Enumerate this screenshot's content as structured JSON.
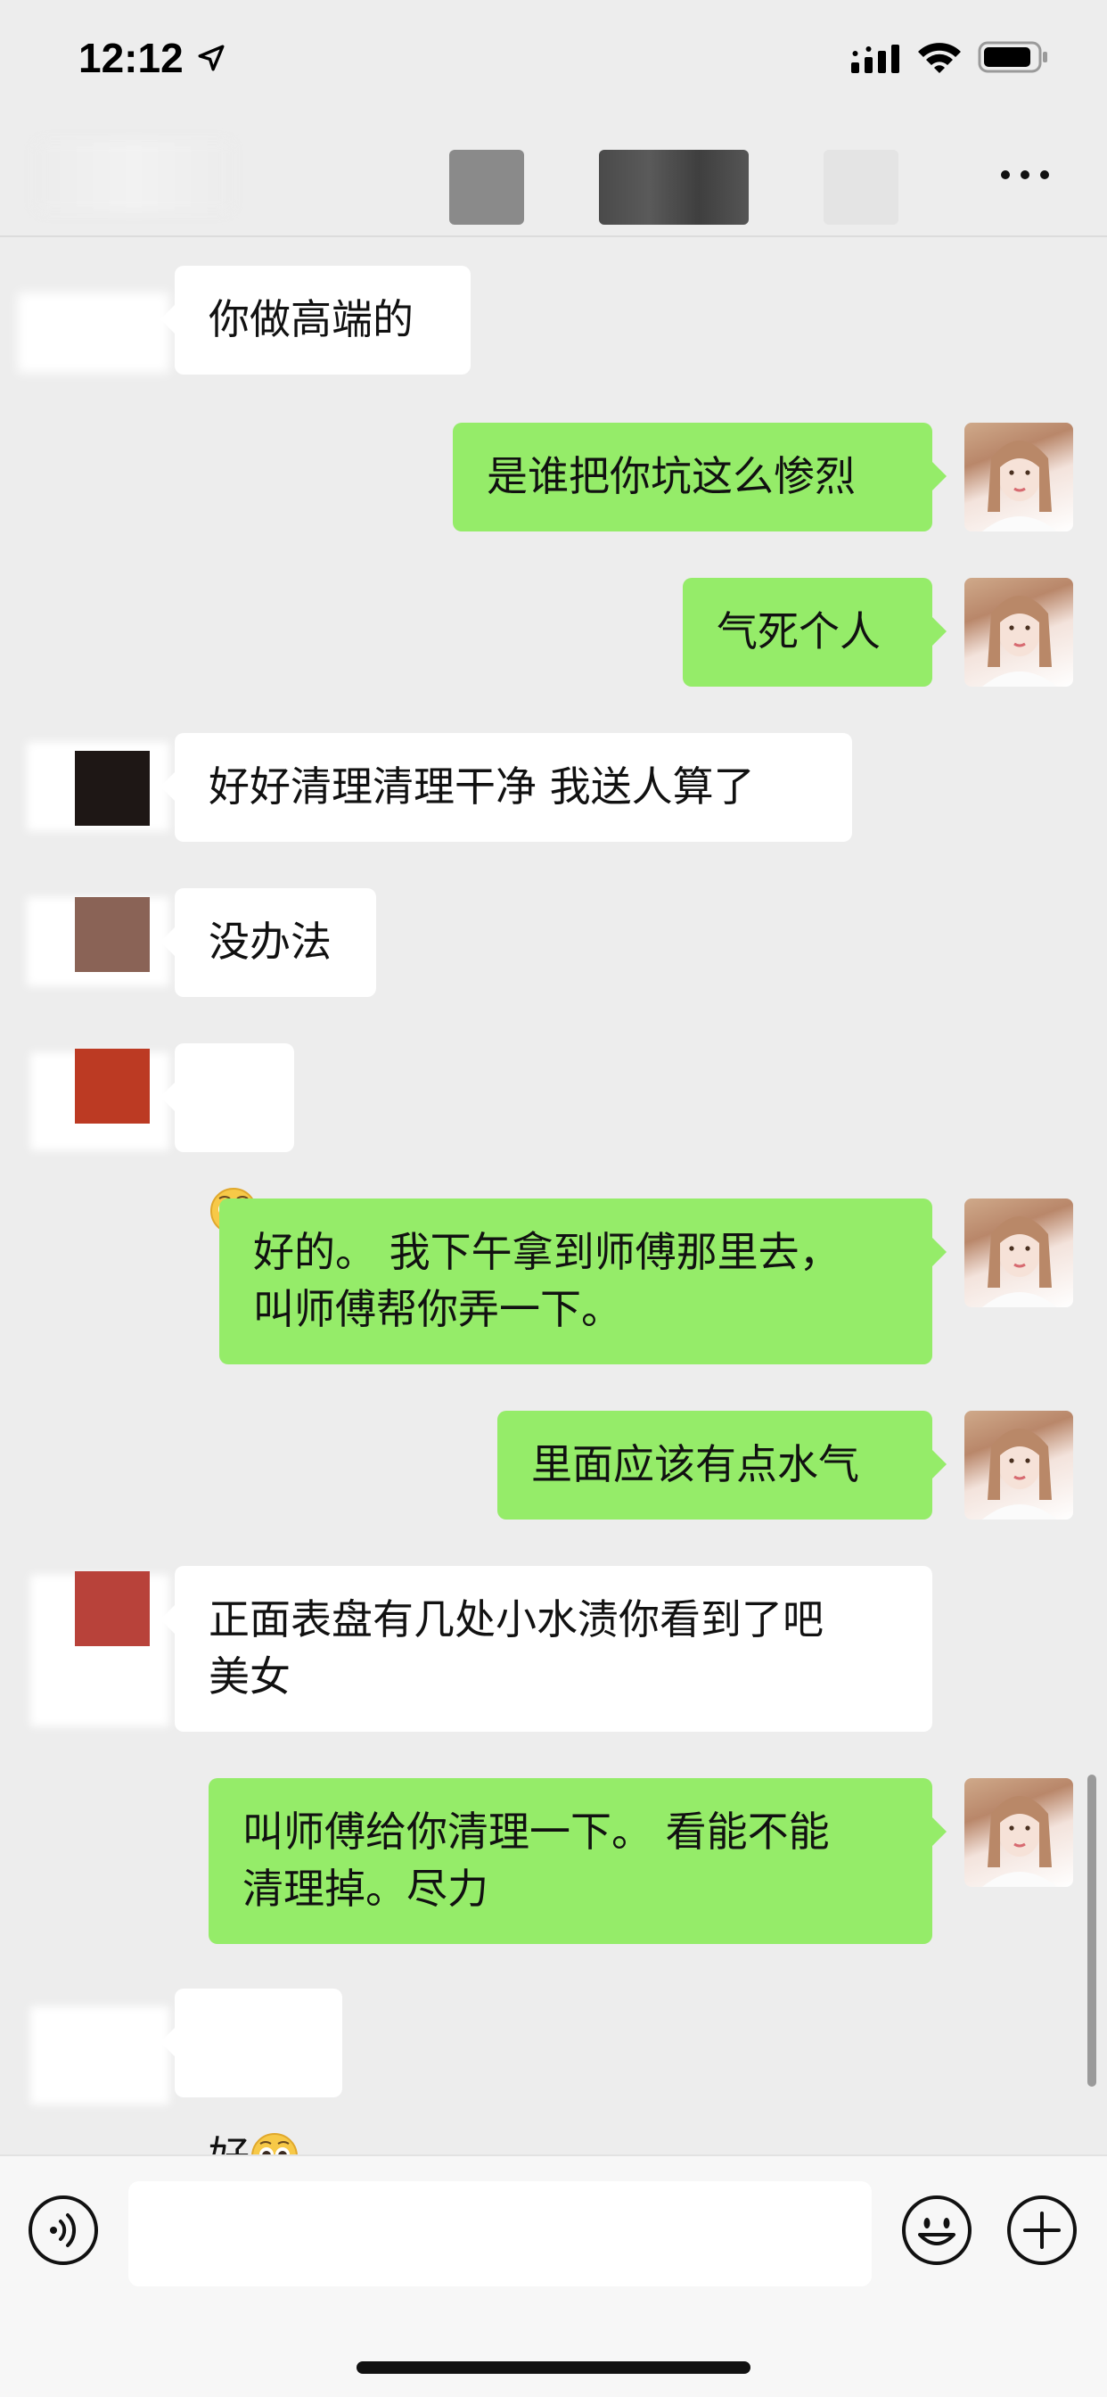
{
  "status_bar": {
    "time": "12:12",
    "icons": [
      "location-arrow-icon",
      "cellular-signal-icon",
      "wifi-icon",
      "battery-icon"
    ]
  },
  "nav": {
    "more_icon": "more-dots-icon"
  },
  "messages": [
    {
      "side": "in",
      "text": "你做高端的"
    },
    {
      "side": "out",
      "text": "是谁把你坑这么惨烈"
    },
    {
      "side": "out",
      "text": "气死个人"
    },
    {
      "side": "in",
      "text": "好好清理清理干净 我送人算了"
    },
    {
      "side": "in",
      "text": "没办法"
    },
    {
      "side": "in",
      "text": "",
      "emoji": "pleading-face-emoji"
    },
    {
      "side": "out",
      "text": "好的。 我下午拿到师傅那里去，\n叫师傅帮你弄一下。"
    },
    {
      "side": "out",
      "text": "里面应该有点水气"
    },
    {
      "side": "in",
      "text": "正面表盘有几处小水渍你看到了吧\n美女"
    },
    {
      "side": "out",
      "text": "叫师傅给你清理一下。 看能不能\n清理掉。尽力"
    },
    {
      "side": "in",
      "text": "好",
      "emoji": "pleading-face-emoji"
    }
  ],
  "input_bar": {
    "voice_icon": "voice-input-icon",
    "emoji_icon": "emoji-icon",
    "plus_icon": "plus-icon",
    "input_value": ""
  },
  "colors": {
    "background": "#ededed",
    "outgoing_bubble": "#95ec69",
    "incoming_bubble": "#ffffff"
  }
}
